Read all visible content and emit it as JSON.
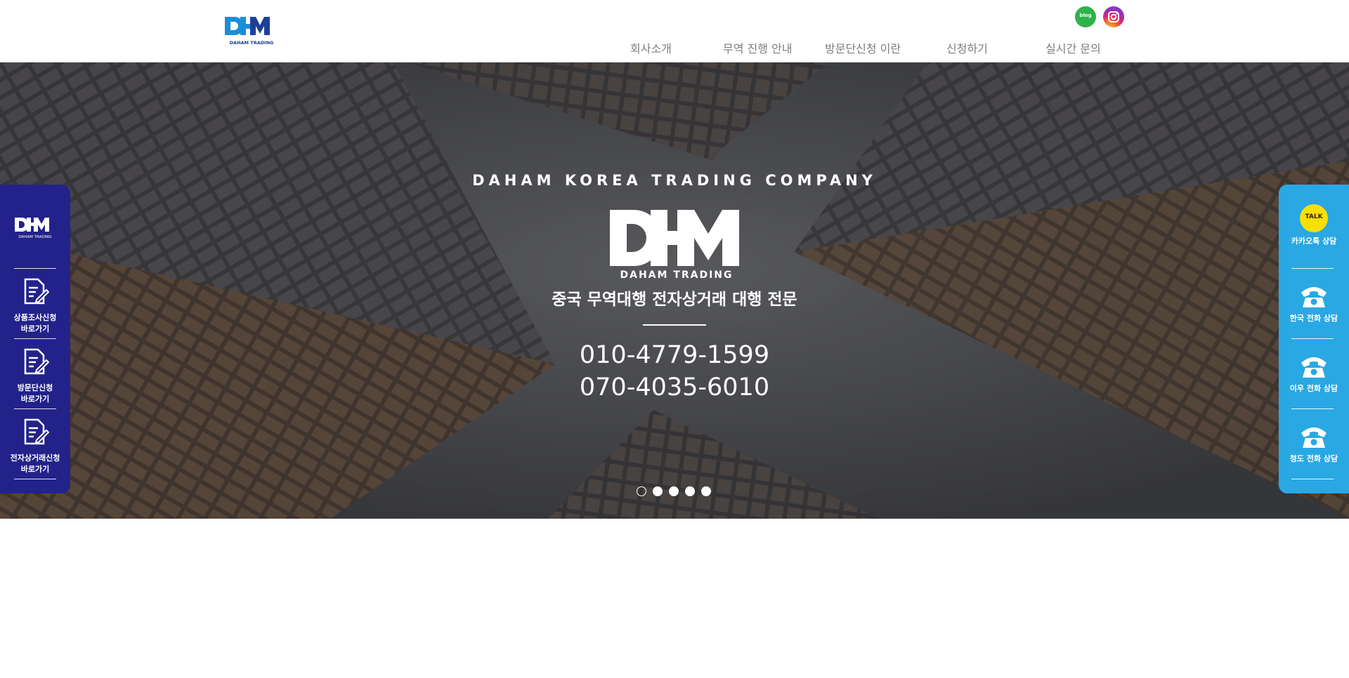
{
  "header": {
    "logo_alt": "DHM DAHAM TRADING",
    "logo_sub": "DAHAM TRADING",
    "social": [
      {
        "name": "blog",
        "label": "blog"
      },
      {
        "name": "instagram",
        "label": ""
      }
    ],
    "nav": [
      "회사소개",
      "무역 진행 안내",
      "방문단신청 이란",
      "신청하기",
      "실시간 문의"
    ]
  },
  "hero": {
    "eyebrow": "DAHAM KOREA TRADING COMPANY",
    "logo_main": "DHM",
    "logo_sub": "DAHAM TRADING",
    "tagline": "중국 무역대행 전자상거래 대행 전문",
    "phones": [
      "010-4779-1599",
      "070-4035-6010"
    ],
    "slides": {
      "count": 5,
      "active": 1
    }
  },
  "left_sidebar": {
    "logo_sub": "DAHAM TRADING",
    "items": [
      {
        "line1": "상품조사신청",
        "line2": "바로가기",
        "icon": "document-pen-icon"
      },
      {
        "line1": "방문단신청",
        "line2": "바로가기",
        "icon": "document-pen-icon"
      },
      {
        "line1": "전자상거래신청",
        "line2": "바로가기",
        "icon": "document-pen-icon"
      }
    ]
  },
  "right_sidebar": {
    "items": [
      {
        "label": "카카오톡 상담",
        "icon": "kakaotalk-icon",
        "icon_text": "TALK"
      },
      {
        "label": "한국 전화 상담",
        "icon": "phone-icon"
      },
      {
        "label": "이우 전화 상담",
        "icon": "phone-icon"
      },
      {
        "label": "청도 전화 상담",
        "icon": "phone-icon"
      }
    ]
  },
  "colors": {
    "left_sidebar": "#23228a",
    "right_sidebar": "#29a8e4",
    "logo_blue": "#1a8fd6",
    "logo_navy": "#1d3f9a",
    "nav_text": "#7d7d7d"
  }
}
